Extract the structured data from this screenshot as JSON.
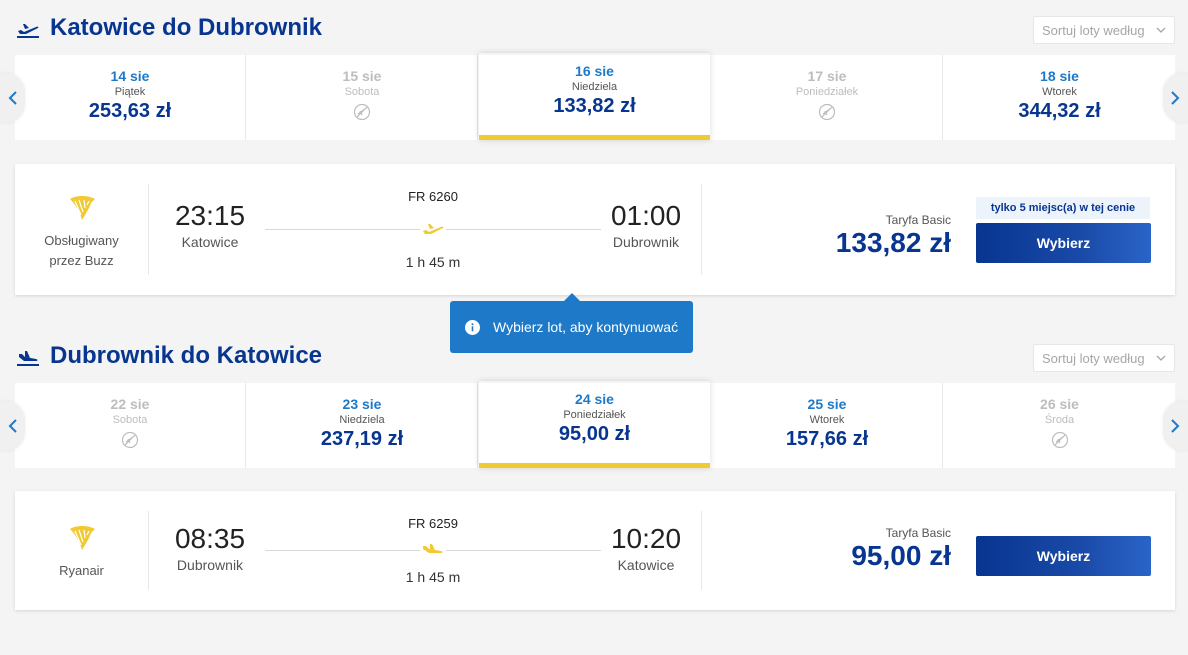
{
  "outbound": {
    "title": "Katowice do Dubrownik",
    "sort_placeholder": "Sortuj loty według",
    "dates": [
      {
        "date": "14 sie",
        "weekday": "Piątek",
        "price": "253,63 zł",
        "available": true,
        "active": false
      },
      {
        "date": "15 sie",
        "weekday": "Sobota",
        "price": "",
        "available": false,
        "active": false
      },
      {
        "date": "16 sie",
        "weekday": "Niedziela",
        "price": "133,82 zł",
        "available": true,
        "active": true
      },
      {
        "date": "17 sie",
        "weekday": "Poniedziałek",
        "price": "",
        "available": false,
        "active": false
      },
      {
        "date": "18 sie",
        "weekday": "Wtorek",
        "price": "344,32 zł",
        "available": true,
        "active": false
      }
    ],
    "flight": {
      "carrier": "Obsługiwany przez Buzz",
      "flight_number": "FR 6260",
      "dep_time": "23:15",
      "dep_city": "Katowice",
      "arr_time": "01:00",
      "arr_city": "Dubrownik",
      "duration": "1 h 45 m",
      "fare_label": "Taryfa Basic",
      "fare_price": "133,82 zł",
      "seats_badge": "tylko 5 miejsc(a) w tej cenie",
      "select_label": "Wybierz"
    }
  },
  "tooltip": {
    "text": "Wybierz lot, aby kontynuować"
  },
  "inbound": {
    "title": "Dubrownik do Katowice",
    "sort_placeholder": "Sortuj loty według",
    "dates": [
      {
        "date": "22 sie",
        "weekday": "Sobota",
        "price": "",
        "available": false,
        "active": false
      },
      {
        "date": "23 sie",
        "weekday": "Niedziela",
        "price": "237,19 zł",
        "available": true,
        "active": false
      },
      {
        "date": "24 sie",
        "weekday": "Poniedziałek",
        "price": "95,00 zł",
        "available": true,
        "active": true
      },
      {
        "date": "25 sie",
        "weekday": "Wtorek",
        "price": "157,66 zł",
        "available": true,
        "active": false
      },
      {
        "date": "26 sie",
        "weekday": "Środa",
        "price": "",
        "available": false,
        "active": false
      }
    ],
    "flight": {
      "carrier": "Ryanair",
      "flight_number": "FR 6259",
      "dep_time": "08:35",
      "dep_city": "Dubrownik",
      "arr_time": "10:20",
      "arr_city": "Katowice",
      "duration": "1 h 45 m",
      "fare_label": "Taryfa Basic",
      "fare_price": "95,00 zł",
      "select_label": "Wybierz"
    }
  },
  "colors": {
    "brand_blue": "#073590",
    "link_blue": "#1e79c8",
    "accent_yellow": "#f1c933"
  },
  "icons": {
    "departure": "plane-takeoff-icon",
    "arrival": "plane-landing-icon",
    "carrier_logo": "ryanair-harp-icon",
    "no_flights": "no-flight-icon",
    "info": "info-icon"
  }
}
